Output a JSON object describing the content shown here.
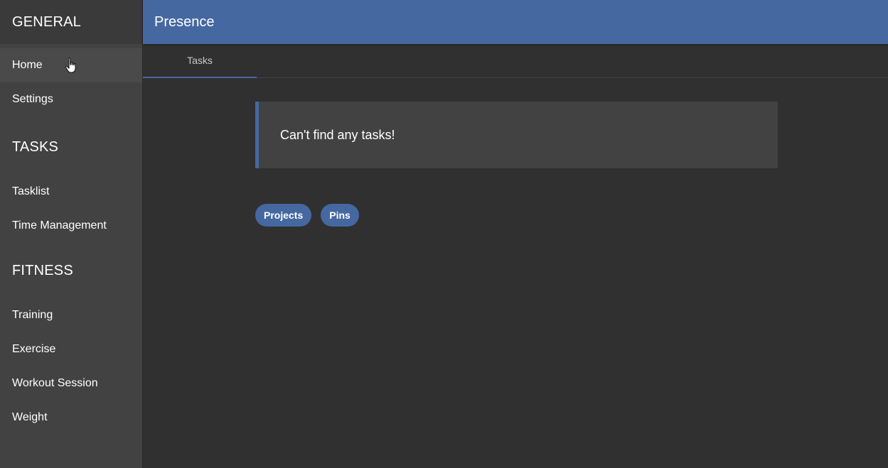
{
  "sidebar": {
    "general_title": "GENERAL",
    "general_items": [
      {
        "label": "Home"
      },
      {
        "label": "Settings"
      }
    ],
    "tasks_title": "TASKS",
    "tasks_items": [
      {
        "label": "Tasklist"
      },
      {
        "label": "Time Management"
      }
    ],
    "fitness_title": "FITNESS",
    "fitness_items": [
      {
        "label": "Training"
      },
      {
        "label": "Exercise"
      },
      {
        "label": "Workout Session"
      },
      {
        "label": "Weight"
      }
    ]
  },
  "header": {
    "title": "Presence"
  },
  "tabs": [
    {
      "label": "Tasks"
    }
  ],
  "main": {
    "empty_message": "Can't find any tasks!",
    "chips": [
      {
        "label": "Projects"
      },
      {
        "label": "Pins"
      }
    ]
  },
  "icons": {
    "cursor": "hand-pointer-icon"
  },
  "colors": {
    "accent": "#4568a0",
    "sidebar_bg": "#424242",
    "main_bg": "#303030",
    "card_bg": "#424242"
  }
}
